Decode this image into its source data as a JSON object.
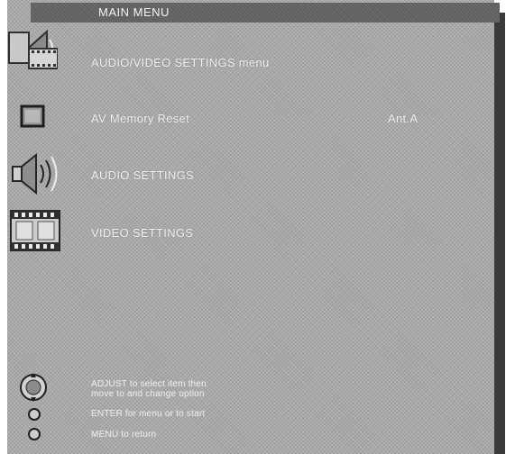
{
  "menu": {
    "title": "MAIN MENU",
    "items": [
      {
        "label": "AUDIO/VIDEO SETTINGS menu",
        "icon": "audio-video-settings-icon",
        "value": ""
      },
      {
        "label": "AV Memory Reset",
        "icon": "memory-reset-icon",
        "value": "Ant.A"
      },
      {
        "label": "AUDIO SETTINGS",
        "icon": "speaker-icon",
        "value": ""
      },
      {
        "label": "VIDEO SETTINGS",
        "icon": "film-strip-icon",
        "value": ""
      }
    ]
  },
  "instructions": [
    {
      "lines": [
        "ADJUST to select item then",
        "move to and change option"
      ],
      "icon": "adjust-dial-icon"
    },
    {
      "lines": [
        "ENTER for menu or to start"
      ],
      "icon": "enter-button-icon"
    },
    {
      "lines": [
        "MENU to return"
      ],
      "icon": "menu-button-icon"
    }
  ],
  "colors": {
    "panel": "#a9a9a9",
    "title_bar": "#5f5f5f",
    "shadow": "#3a3a3a",
    "text": "#f4f4f4"
  }
}
